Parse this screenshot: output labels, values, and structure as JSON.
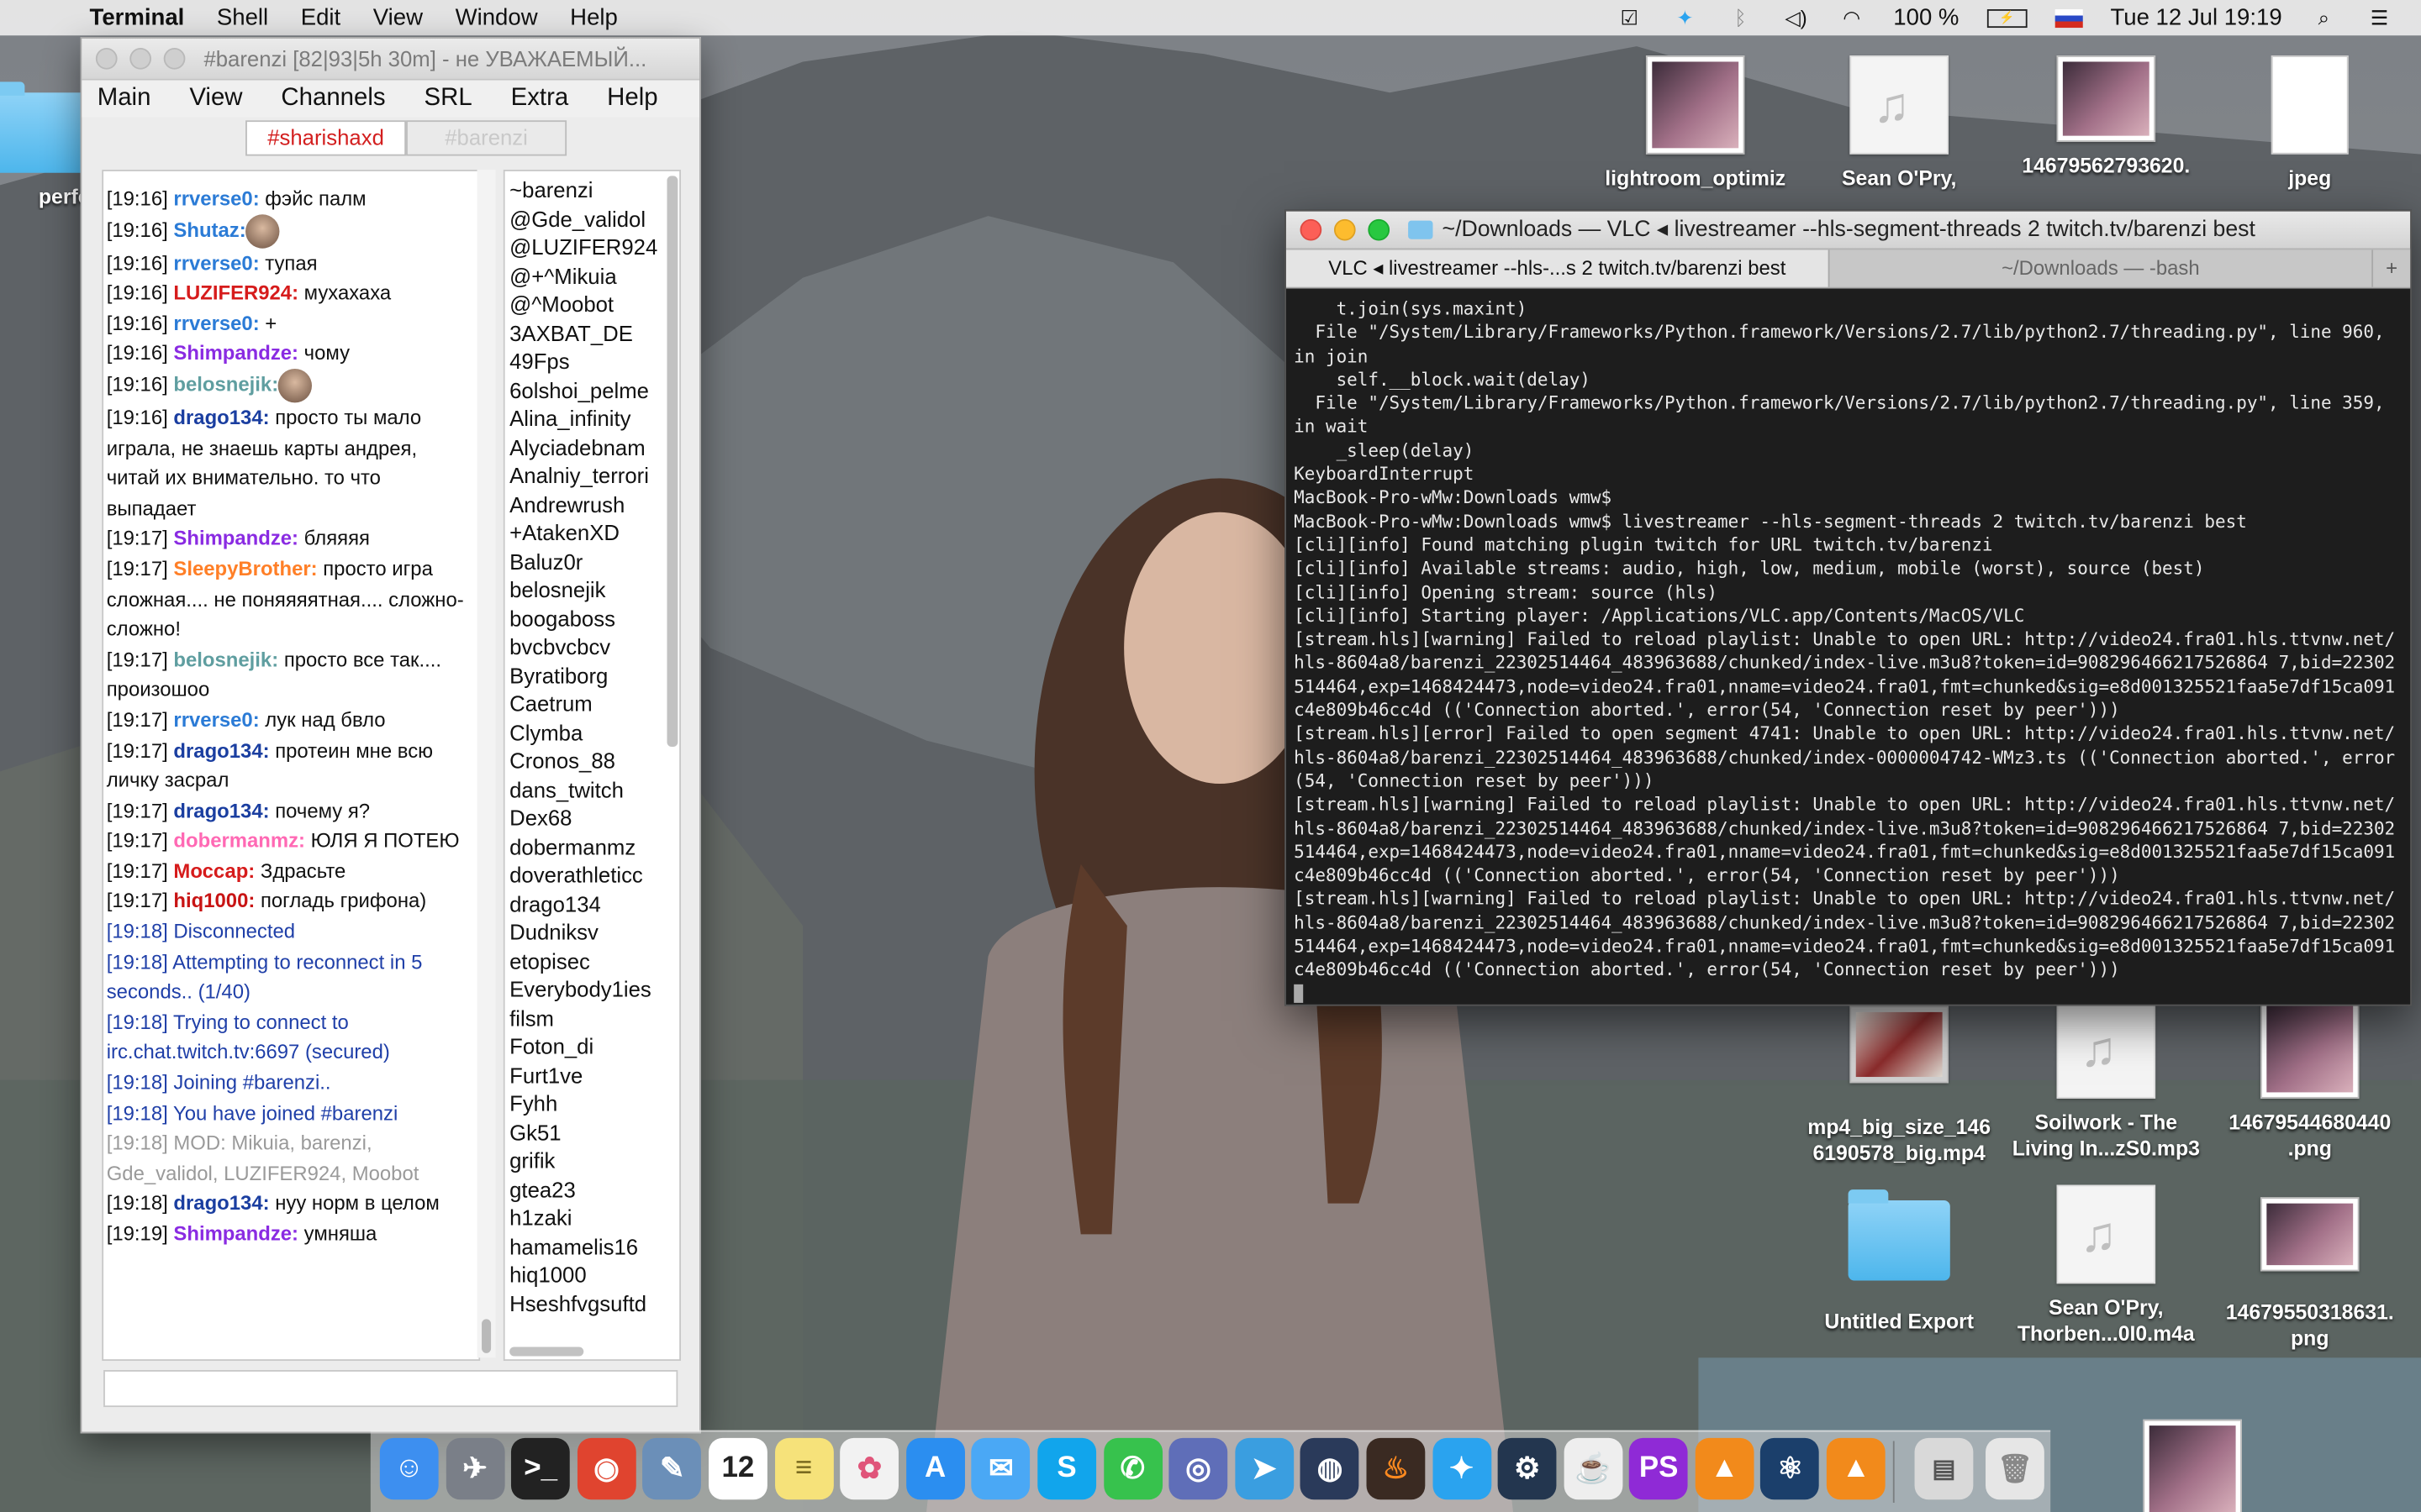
{
  "menubar": {
    "app_name": "Terminal",
    "menus": [
      "Shell",
      "Edit",
      "View",
      "Window",
      "Help"
    ],
    "battery": "100 %",
    "datetime": "Tue 12 Jul  19:19"
  },
  "desktop_icons": [
    {
      "label": "lightroom_optimiz"
    },
    {
      "label": "Sean O'Pry,"
    },
    {
      "label": "14679562793620."
    },
    {
      "label": "jpeg"
    },
    {
      "label": "perfe"
    },
    {
      "label": "mp4_big_size_146\n6190578_big.mp4"
    },
    {
      "label": "Soilwork - The\nLiving In...zS0.mp3"
    },
    {
      "label": "14679544680440\n.png"
    },
    {
      "label": "Untitled Export"
    },
    {
      "label": "Sean O'Pry,\nThorben...0I0.m4a"
    },
    {
      "label": "14679550318631.\npng"
    }
  ],
  "irc": {
    "title": "#barenzi [82|93|5h 30m] - не УВАЖАЕМЫЙ...",
    "menus": [
      "Main",
      "View",
      "Channels",
      "SRL",
      "Extra",
      "Help"
    ],
    "tabs": [
      "#sharishaxd",
      "#barenzi"
    ],
    "messages": [
      {
        "time": "[19:16]",
        "nick": "rrverse0:",
        "color": "#2b7bd6",
        "text": " фэйс палм"
      },
      {
        "time": "[19:16]",
        "nick": "Shutaz:",
        "color": "#2b7bd6",
        "text": ""
      },
      {
        "time": "[19:16]",
        "nick": "rrverse0:",
        "color": "#2b7bd6",
        "text": " тупая"
      },
      {
        "time": "[19:16]",
        "nick": "LUZIFER924:",
        "color": "#d61b1b",
        "text": " мухахаха"
      },
      {
        "time": "[19:16]",
        "nick": "rrverse0:",
        "color": "#2b7bd6",
        "text": " +"
      },
      {
        "time": "[19:16]",
        "nick": "Shimpandze:",
        "color": "#8a2be2",
        "text": " чому"
      },
      {
        "time": "[19:16]",
        "nick": "belosnejik:",
        "color": "#5f9ea0",
        "text": ""
      },
      {
        "time": "[19:16]",
        "nick": "drago134:",
        "color": "#1a3ea0",
        "text": " просто ты мало играла, не знаешь карты андрея, читай их внимательно. то что выпадает"
      },
      {
        "time": "[19:17]",
        "nick": "Shimpandze:",
        "color": "#8a2be2",
        "text": " бляяяя"
      },
      {
        "time": "[19:17]",
        "nick": "SleepyBrother:",
        "color": "#ff7f27",
        "text": " просто игра сложная.... не поняяяятная.... сложно-сложно!"
      },
      {
        "time": "[19:17]",
        "nick": "belosnejik:",
        "color": "#5f9ea0",
        "text": " просто все так.... произошоо"
      },
      {
        "time": "[19:17]",
        "nick": "rrverse0:",
        "color": "#2b7bd6",
        "text": " лук над бвло"
      },
      {
        "time": "[19:17]",
        "nick": "drago134:",
        "color": "#1a3ea0",
        "text": " протеин мне всю личку засрал"
      },
      {
        "time": "[19:17]",
        "nick": "drago134:",
        "color": "#1a3ea0",
        "text": " почему я?"
      },
      {
        "time": "[19:17]",
        "nick": "dobermanmz:",
        "color": "#ff69b4",
        "text": " ЮЛЯ Я ПОТЕЮ"
      },
      {
        "time": "[19:17]",
        "nick": "Моссар:",
        "color": "#d61b1b",
        "text": " Здрасьте"
      },
      {
        "time": "[19:17]",
        "nick": "hiq1000:",
        "color": "#c81414",
        "text": " погладь грифона)"
      },
      {
        "time": "",
        "nick": "",
        "color": "#1f3fa8",
        "text": "[19:18] Disconnected",
        "cls": "sys"
      },
      {
        "time": "",
        "nick": "",
        "color": "#1f3fa8",
        "text": "[19:18] Attempting to reconnect in 5 seconds.. (1/40)",
        "cls": "sys"
      },
      {
        "time": "",
        "nick": "",
        "color": "#1f3fa8",
        "text": "[19:18] Trying to connect to irc.chat.twitch.tv:6697 (secured)",
        "cls": "sys"
      },
      {
        "time": "",
        "nick": "",
        "color": "#1f3fa8",
        "text": "[19:18] Joining #barenzi..",
        "cls": "sys"
      },
      {
        "time": "",
        "nick": "",
        "color": "#1f3fa8",
        "text": "[19:18] You have joined #barenzi",
        "cls": "sys"
      },
      {
        "time": "",
        "nick": "",
        "color": "#9a9a9a",
        "text": "[19:18] MOD: Mikuia, barenzi, Gde_validol, LUZIFER924, Moobot",
        "cls": "sysg"
      },
      {
        "time": "[19:18]",
        "nick": "drago134:",
        "color": "#1a3ea0",
        "text": " нуу норм в целом"
      },
      {
        "time": "[19:19]",
        "nick": "Shimpandze:",
        "color": "#8a2be2",
        "text": " умняша"
      }
    ],
    "users": [
      "~barenzi",
      "@Gde_validol",
      "@LUZIFER924",
      "@+^Mikuia",
      "@^Moobot",
      "3AXBAT_DE",
      "49Fps",
      "6olshoi_pelme",
      "Alina_infinity",
      "Alyciadebnam",
      "Analniy_terrori",
      "Andrewrush",
      "+AtakenXD",
      "Baluz0r",
      "belosnejik",
      "boogaboss",
      "bvcbvcbcv",
      "Byratiborg",
      "Caetrum",
      "Clymba",
      "Cronos_88",
      "dans_twitch",
      "Dex68",
      "dobermanmz",
      "doverathleticc",
      "drago134",
      "Dudniksv",
      "etopisec",
      "Everybody1ies",
      "filsm",
      "Foton_di",
      "Furt1ve",
      "Fyhh",
      "Gk51",
      "grifik",
      "gtea23",
      "h1zaki",
      "hamamelis16",
      "hiq1000",
      "Hseshfvgsuftd"
    ]
  },
  "terminal": {
    "title": "~/Downloads — VLC ◂ livestreamer --hls-segment-threads 2 twitch.tv/barenzi best",
    "tabs": [
      "VLC ◂ livestreamer --hls-...s 2 twitch.tv/barenzi best",
      "~/Downloads — -bash"
    ],
    "output": "    t.join(sys.maxint)\n  File \"/System/Library/Frameworks/Python.framework/Versions/2.7/lib/python2.7/threading.py\", line 960, in join\n    self.__block.wait(delay)\n  File \"/System/Library/Frameworks/Python.framework/Versions/2.7/lib/python2.7/threading.py\", line 359, in wait\n    _sleep(delay)\nKeyboardInterrupt\nMacBook-Pro-wMw:Downloads wmw$\nMacBook-Pro-wMw:Downloads wmw$ livestreamer --hls-segment-threads 2 twitch.tv/barenzi best\n[cli][info] Found matching plugin twitch for URL twitch.tv/barenzi\n[cli][info] Available streams: audio, high, low, medium, mobile (worst), source (best)\n[cli][info] Opening stream: source (hls)\n[cli][info] Starting player: /Applications/VLC.app/Contents/MacOS/VLC\n[stream.hls][warning] Failed to reload playlist: Unable to open URL: http://video24.fra01.hls.ttvnw.net/hls-8604a8/barenzi_22302514464_483963688/chunked/index-live.m3u8?token=id=908296466217526864 7,bid=22302514464,exp=1468424473,node=video24.fra01,nname=video24.fra01,fmt=chunked&sig=e8d001325521faa5e7df15ca091c4e809b46cc4d (('Connection aborted.', error(54, 'Connection reset by peer')))\n[stream.hls][error] Failed to open segment 4741: Unable to open URL: http://video24.fra01.hls.ttvnw.net/hls-8604a8/barenzi_22302514464_483963688/chunked/index-0000004742-WMz3.ts (('Connection aborted.', error(54, 'Connection reset by peer')))\n[stream.hls][warning] Failed to reload playlist: Unable to open URL: http://video24.fra01.hls.ttvnw.net/hls-8604a8/barenzi_22302514464_483963688/chunked/index-live.m3u8?token=id=908296466217526864 7,bid=22302514464,exp=1468424473,node=video24.fra01,nname=video24.fra01,fmt=chunked&sig=e8d001325521faa5e7df15ca091c4e809b46cc4d (('Connection aborted.', error(54, 'Connection reset by peer')))\n[stream.hls][warning] Failed to reload playlist: Unable to open URL: http://video24.fra01.hls.ttvnw.net/hls-8604a8/barenzi_22302514464_483963688/chunked/index-live.m3u8?token=id=908296466217526864 7,bid=22302514464,exp=1468424473,node=video24.fra01,nname=video24.fra01,fmt=chunked&sig=e8d001325521faa5e7df15ca091c4e809b46cc4d (('Connection aborted.', error(54, 'Connection reset by peer')))"
  },
  "dock": {
    "apps": [
      {
        "icon": "finder-icon",
        "color": "#3d8ff0",
        "glyph": "☺"
      },
      {
        "icon": "launchpad-icon",
        "color": "#7a7f88",
        "glyph": "✈"
      },
      {
        "icon": "terminal-icon",
        "color": "#222222",
        "glyph": ">_"
      },
      {
        "icon": "chrome-icon",
        "color": "#e0442f",
        "glyph": "◉"
      },
      {
        "icon": "preview-icon",
        "color": "#6b8fb8",
        "glyph": "✎"
      },
      {
        "icon": "calendar-icon",
        "color": "#ffffff",
        "glyph": "12",
        "fg": "#222222"
      },
      {
        "icon": "notes-icon",
        "color": "#f6e27a",
        "glyph": "≡",
        "fg": "#7a6a20"
      },
      {
        "icon": "photos-icon",
        "color": "#f2f2f2",
        "glyph": "✿",
        "fg": "#e0557a"
      },
      {
        "icon": "appstore-icon",
        "color": "#2b8ef0",
        "glyph": "A"
      },
      {
        "icon": "messages-icon",
        "color": "#4aa8f5",
        "glyph": "✉"
      },
      {
        "icon": "skype-icon",
        "color": "#11a5ec",
        "glyph": "S"
      },
      {
        "icon": "whatsapp-icon",
        "color": "#37c24d",
        "glyph": "✆"
      },
      {
        "icon": "discord-icon",
        "color": "#5f6eb8",
        "glyph": "◎"
      },
      {
        "icon": "telegram-icon",
        "color": "#3a9ee0",
        "glyph": "➤"
      },
      {
        "icon": "speaker-icon",
        "color": "#2a3a5a",
        "glyph": "◍"
      },
      {
        "icon": "fire-icon",
        "color": "#3a2a22",
        "glyph": "♨",
        "fg": "#ff8a1f"
      },
      {
        "icon": "twitter-icon",
        "color": "#2aa3ef",
        "glyph": "✦"
      },
      {
        "icon": "steam-icon",
        "color": "#23364f",
        "glyph": "⚙"
      },
      {
        "icon": "java-icon",
        "color": "#eeeeee",
        "glyph": "☕",
        "fg": "#c4382f"
      },
      {
        "icon": "phpstorm-icon",
        "color": "#8f2ad6",
        "glyph": "PS"
      },
      {
        "icon": "vlc-icon",
        "color": "#f28a1b",
        "glyph": "▲"
      },
      {
        "icon": "atom-icon",
        "color": "#1b3f6b",
        "glyph": "⚛"
      },
      {
        "icon": "vlc2-icon",
        "color": "#f28a1b",
        "glyph": "▲"
      }
    ]
  },
  "colors": {
    "accent": "#d31f1f",
    "link": "#1f3fa8"
  }
}
